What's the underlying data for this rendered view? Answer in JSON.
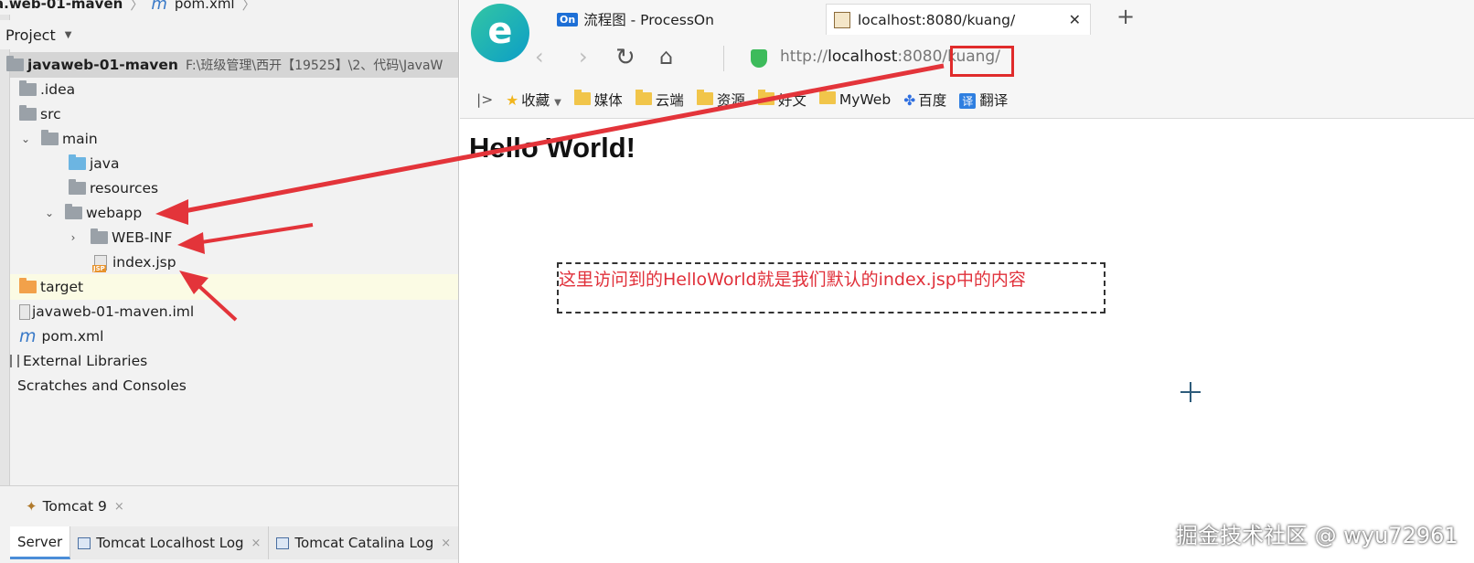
{
  "ide": {
    "breadcrumb": {
      "project": "a.web-01-maven",
      "file": "pom.xml"
    },
    "project_label": "Project",
    "tree": {
      "root_name": "javaweb-01-maven",
      "root_path": "F:\\班级管理\\西开【19525】\\2、代码\\JavaW",
      "idea": ".idea",
      "src": "src",
      "main": "main",
      "java": "java",
      "resources": "resources",
      "webapp": "webapp",
      "webinf": "WEB-INF",
      "index": "index.jsp",
      "target": "target",
      "iml": "javaweb-01-maven.iml",
      "pom": "pom.xml",
      "libraries": "External Libraries",
      "scratches": "Scratches and Consoles"
    },
    "run_tab": "Tomcat 9",
    "server_tabs": [
      "Server",
      "Tomcat Localhost Log",
      "Tomcat Catalina Log"
    ]
  },
  "browser": {
    "tabs": [
      {
        "badge": "On",
        "title": "流程图 - ProcessOn"
      },
      {
        "title": "localhost:8080/kuang/"
      }
    ],
    "url": {
      "scheme": "http://",
      "host": "localhost",
      "port": ":8080",
      "path": "/kuang/"
    },
    "bookmarks": {
      "fav": "收藏",
      "items": [
        "媒体",
        "云端",
        "资源",
        "好文",
        "MyWeb"
      ],
      "baidu": "百度",
      "translate": "翻译"
    },
    "page_heading": "Hello World!",
    "annotation": "这里访问到的HelloWorld就是我们默认的index.jsp中的内容",
    "watermark": "掘金技术社区 @ wyu72961"
  },
  "colors": {
    "annotation_red": "#e02b2b",
    "folder_yellow": "#f1c54a",
    "tab_active_underline": "#4a8dd8"
  }
}
